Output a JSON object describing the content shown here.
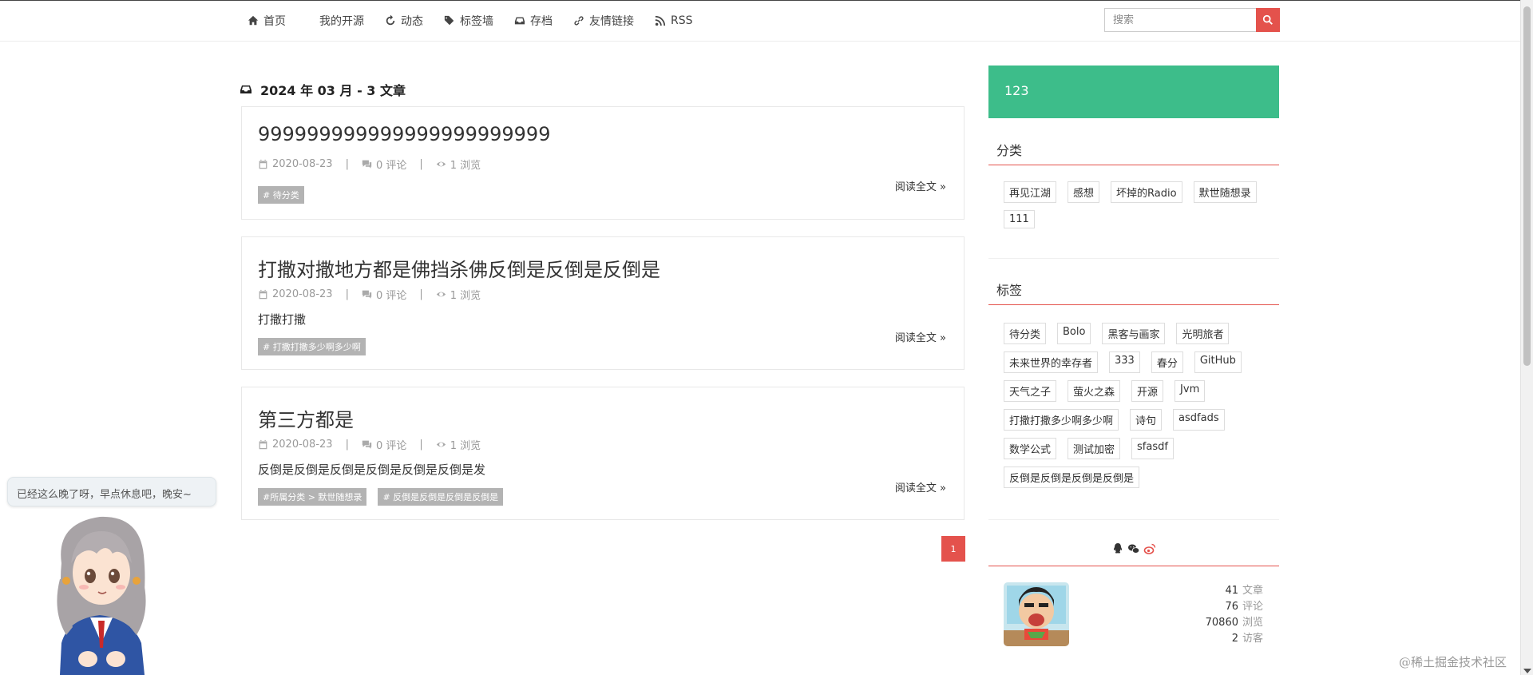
{
  "nav": {
    "items": [
      {
        "label": "首页",
        "icon": "home-icon"
      },
      {
        "label": "我的开源",
        "icon": ""
      },
      {
        "label": "动态",
        "icon": "refresh-icon"
      },
      {
        "label": "标签墙",
        "icon": "tags-icon"
      },
      {
        "label": "存档",
        "icon": "inbox-icon"
      },
      {
        "label": "友情链接",
        "icon": "link-icon"
      },
      {
        "label": "RSS",
        "icon": "rss-icon"
      }
    ],
    "search_placeholder": "搜索"
  },
  "archive": {
    "heading": "2024 年 03 月 - 3 文章"
  },
  "posts": [
    {
      "title": "999999999999999999999999",
      "date": "2020-08-23",
      "comments": "0 评论",
      "views": "1 浏览",
      "excerpt": "",
      "tags": [
        "# 待分类"
      ],
      "read_more": "阅读全文 »"
    },
    {
      "title": "打撒对撒地方都是佛挡杀佛反倒是反倒是反倒是",
      "date": "2020-08-23",
      "comments": "0 评论",
      "views": "1 浏览",
      "excerpt": "打撒打撒",
      "tags": [
        "# 打撒打撒多少啊多少啊"
      ],
      "read_more": "阅读全文 »"
    },
    {
      "title": "第三方都是",
      "date": "2020-08-23",
      "comments": "0 评论",
      "views": "1 浏览",
      "excerpt": "反倒是反倒是反倒是反倒是反倒是反倒是发",
      "tags": [
        "#所属分类 > 默世随想录",
        "# 反倒是反倒是反倒是反倒是"
      ],
      "read_more": "阅读全文 »"
    }
  ],
  "pagination": {
    "current": "1"
  },
  "sidebar": {
    "hello_text": "123",
    "categories_title": "分类",
    "categories": [
      "再见江湖",
      "感想",
      "坏掉的Radio",
      "默世随想录",
      "111"
    ],
    "tags_title": "标签",
    "tags": [
      "待分类",
      "Bolo",
      "黑客与画家",
      "光明旅者",
      "未来世界的幸存者",
      "333",
      "春分",
      "GitHub",
      "天气之子",
      "萤火之森",
      "开源",
      "Jvm",
      "打撒打撒多少啊多少啊",
      "诗句",
      "asdfads",
      "数学公式",
      "测试加密",
      "sfasdf",
      "反倒是反倒是反倒是反倒是"
    ],
    "social_icons": [
      "qq-icon",
      "wechat-icon",
      "weibo-icon"
    ],
    "stats": [
      {
        "num": "41",
        "label": "文章"
      },
      {
        "num": "76",
        "label": "评论"
      },
      {
        "num": "70860",
        "label": "浏览"
      },
      {
        "num": "2",
        "label": "访客"
      }
    ]
  },
  "mascot": {
    "message": "已经这么晚了呀，早点休息吧，晚安~"
  },
  "watermark": "@稀土掘金技术社区",
  "colors": {
    "accent_red": "#e4524c",
    "accent_green": "#3dbd8a",
    "tag_gray": "#b3b3b3"
  }
}
